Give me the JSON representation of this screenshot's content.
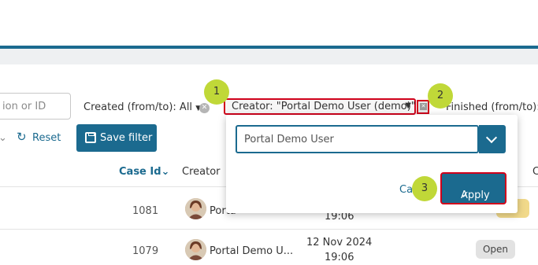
{
  "filters": {
    "search_placeholder": "ion or ID",
    "created_label": "Created (from/to): All",
    "creator_label": "Creator: \"Portal Demo User (demo)\"",
    "finished_label": "Finished (from/to):",
    "reset_label": "Reset",
    "save_filter_label": "Save filter"
  },
  "badges": {
    "b1": "1",
    "b2": "2",
    "b3": "3"
  },
  "popup": {
    "input_value": "Portal Demo User",
    "cancel_label": "Ca",
    "apply_label": "Apply"
  },
  "table": {
    "columns": {
      "case_id": "Case Id",
      "creator": "Creator",
      "c_partial": "C"
    },
    "rows": [
      {
        "case_id": "1081",
        "creator": "Porta",
        "time": "19:06"
      },
      {
        "case_id": "1079",
        "creator": "Portal Demo U...",
        "date": "12 Nov 2024",
        "time": "19:06",
        "status": "Open"
      }
    ]
  },
  "colors": {
    "primary": "#1b6a8f",
    "highlight": "#d0021b",
    "badge": "#c0d838"
  }
}
